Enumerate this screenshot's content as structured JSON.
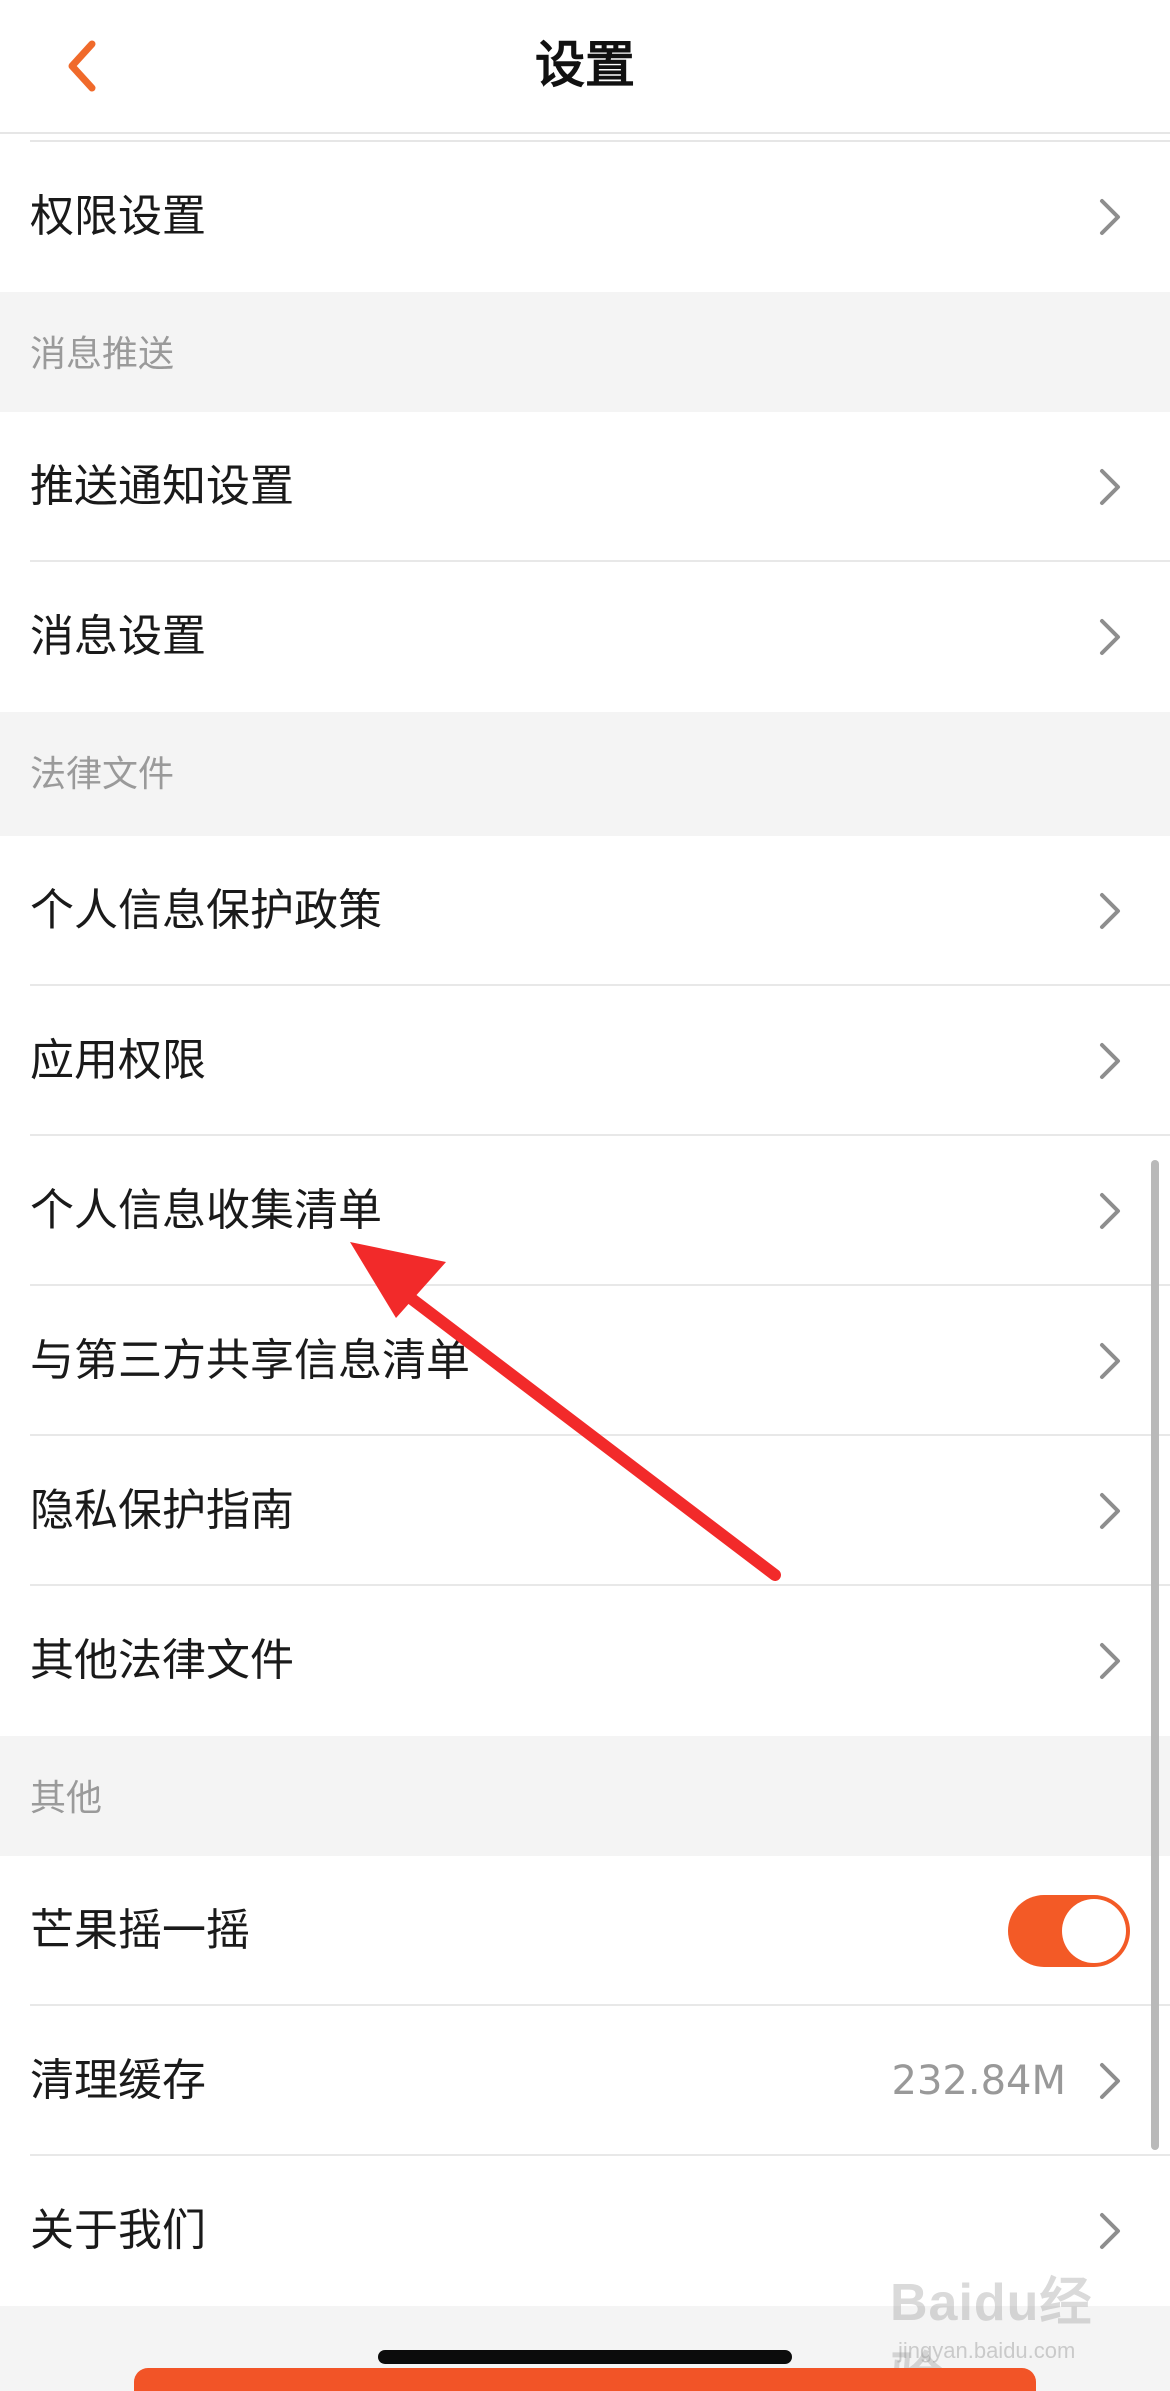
{
  "nav": {
    "title": "设置",
    "back_icon": "chevron-left-icon",
    "accent": "#f06a2b"
  },
  "rows": {
    "permission_settings": "权限设置",
    "push_notification_settings": "推送通知设置",
    "message_settings": "消息设置",
    "personal_info_protection_policy": "个人信息保护政策",
    "app_permissions": "应用权限",
    "personal_info_collection_list": "个人信息收集清单",
    "third_party_sharing_list": "与第三方共享信息清单",
    "privacy_guide": "隐私保护指南",
    "other_legal_documents": "其他法律文件",
    "mango_shake": "芒果摇一摇",
    "clear_cache": "清理缓存",
    "about_us": "关于我们"
  },
  "sections": {
    "message_push": "消息推送",
    "legal_documents": "法律文件",
    "other": "其他"
  },
  "cache_size": "232.84M",
  "mango_shake_enabled": true,
  "toggle_color": "#f35a26",
  "annotation_arrow_color": "#f22a2a",
  "watermark": {
    "logo": "Baidu经验",
    "url": "jingyan.baidu.com"
  }
}
